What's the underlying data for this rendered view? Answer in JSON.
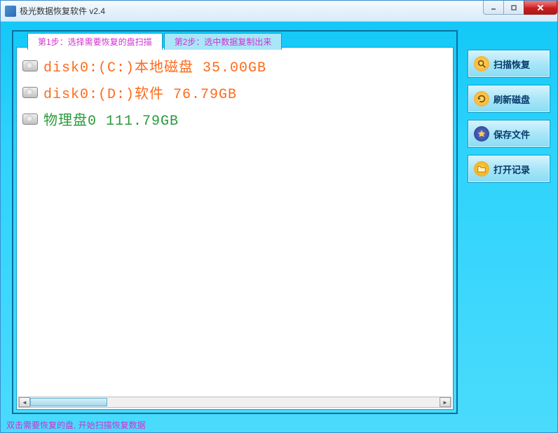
{
  "titlebar": {
    "title": "极光数据恢复软件 v2.4"
  },
  "tabs": {
    "step1": "第1步：选择需要恢复的盘扫描",
    "step2": "第2步：选中数据复制出来"
  },
  "disks": [
    {
      "label": "disk0:(C:)本地磁盘 35.00GB",
      "type": "logical"
    },
    {
      "label": "disk0:(D:)软件 76.79GB",
      "type": "logical"
    },
    {
      "label": "物理盘0 111.79GB",
      "type": "physical"
    }
  ],
  "sidebar": {
    "scan": "扫描恢复",
    "refresh": "刷新磁盘",
    "save": "保存文件",
    "open": "打开记录"
  },
  "status": "双击需要恢复的盘, 开始扫描恢复数据"
}
